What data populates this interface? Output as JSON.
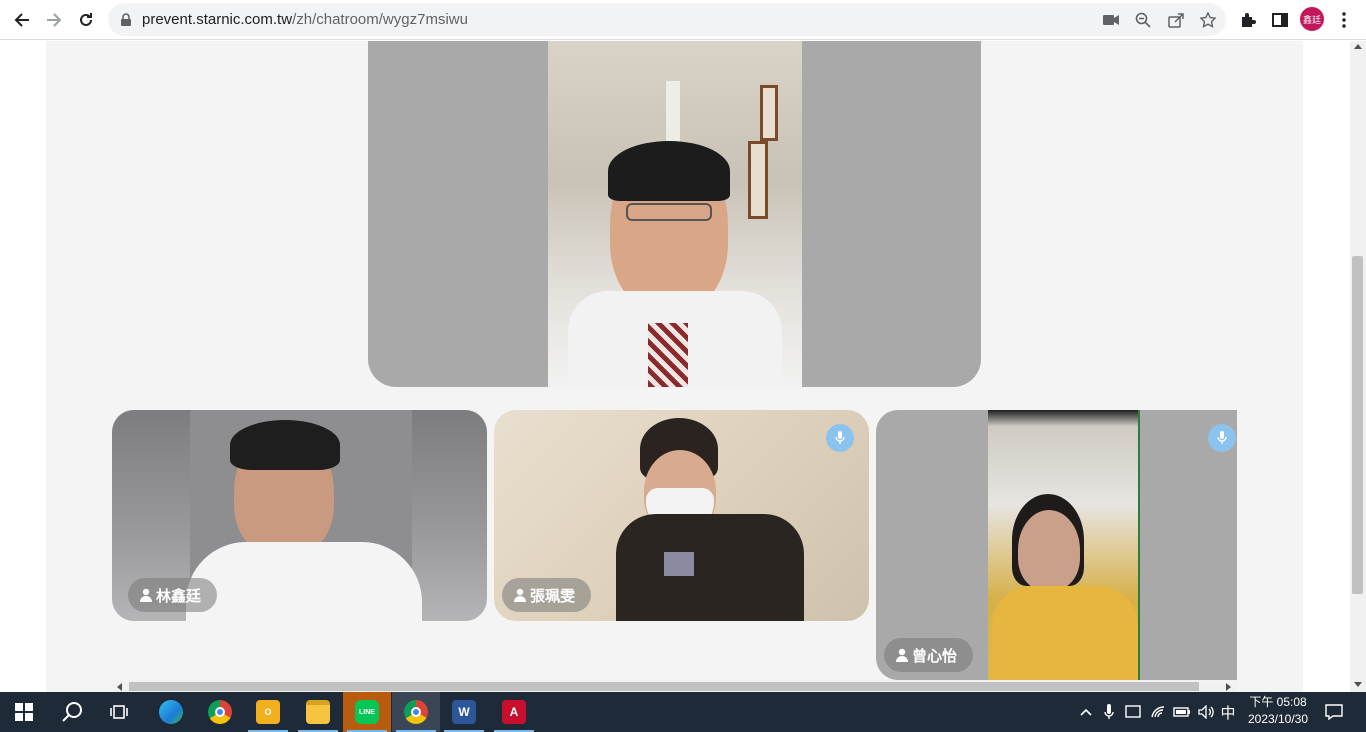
{
  "browser": {
    "url_host": "prevent.starnic.com.tw",
    "url_path": "/zh/chatroom/wygz7msiwu",
    "profile_initials": "鑫廷"
  },
  "participants": [
    {
      "name": "林鑫廷",
      "mic_icon": false
    },
    {
      "name": "張珮雯",
      "mic_icon": true
    },
    {
      "name": "曾心怡",
      "mic_icon": true
    }
  ],
  "taskbar": {
    "apps": [
      "start",
      "search",
      "task-view",
      "edge",
      "chrome",
      "outlook",
      "file-explorer",
      "line",
      "chrome-profile",
      "word",
      "acrobat"
    ],
    "input_method": "中",
    "time": "下午 05:08",
    "date": "2023/10/30"
  },
  "colors": {
    "tile_gray": "#a9a9a9",
    "mic_badge": "#8cc3ee",
    "taskbar": "#1f2a38",
    "profile_avatar": "#c2185b"
  }
}
